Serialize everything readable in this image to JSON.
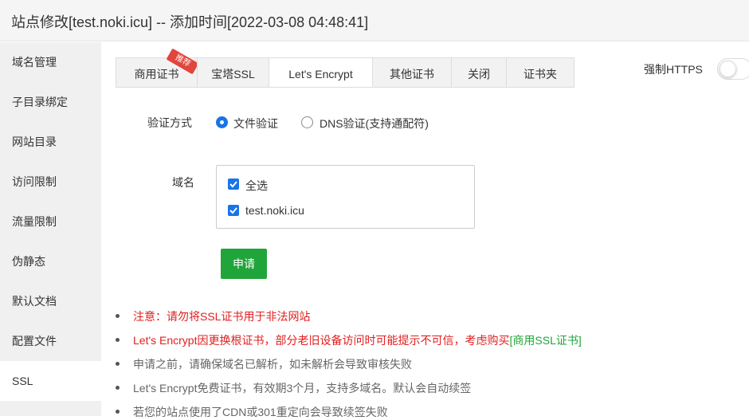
{
  "window": {
    "title": "站点修改[test.noki.icu] -- 添加时间[2022-03-08 04:48:41]"
  },
  "sidebar": {
    "items": [
      {
        "label": "域名管理"
      },
      {
        "label": "子目录绑定"
      },
      {
        "label": "网站目录"
      },
      {
        "label": "访问限制"
      },
      {
        "label": "流量限制"
      },
      {
        "label": "伪静态"
      },
      {
        "label": "默认文档"
      },
      {
        "label": "配置文件"
      },
      {
        "label": "SSL",
        "active": true
      }
    ]
  },
  "tabs": {
    "items": [
      {
        "label": "商用证书",
        "badge": "推荐"
      },
      {
        "label": "宝塔SSL"
      },
      {
        "label": "Let's Encrypt",
        "active": true
      },
      {
        "label": "其他证书"
      },
      {
        "label": "关闭"
      },
      {
        "label": "证书夹"
      }
    ]
  },
  "force_https": {
    "label": "强制HTTPS",
    "enabled": false
  },
  "verify": {
    "label": "验证方式",
    "options": [
      {
        "label": "文件验证",
        "checked": true
      },
      {
        "label": "DNS验证(支持通配符)",
        "checked": false
      }
    ]
  },
  "domains": {
    "label": "域名",
    "items": [
      {
        "label": "全选",
        "checked": true
      },
      {
        "label": "test.noki.icu",
        "checked": true
      }
    ]
  },
  "apply_button": {
    "label": "申请"
  },
  "notes": {
    "n1": "注意：请勿将SSL证书用于非法网站",
    "n2_text": "Let's Encrypt因更换根证书，部分老旧设备访问时可能提示不可信，考虑购买",
    "n2_link": "[商用SSL证书]",
    "n3": "申请之前，请确保域名已解析，如未解析会导致审核失败",
    "n4": "Let's Encrypt免费证书，有效期3个月，支持多域名。默认会自动续签",
    "n5": "若您的站点使用了CDN或301重定向会导致续签失败"
  },
  "colors": {
    "accent_green": "#20a53a",
    "warning_red": "#e02020",
    "checkbox_blue": "#1a73e8",
    "badge_red": "#e0463c"
  }
}
